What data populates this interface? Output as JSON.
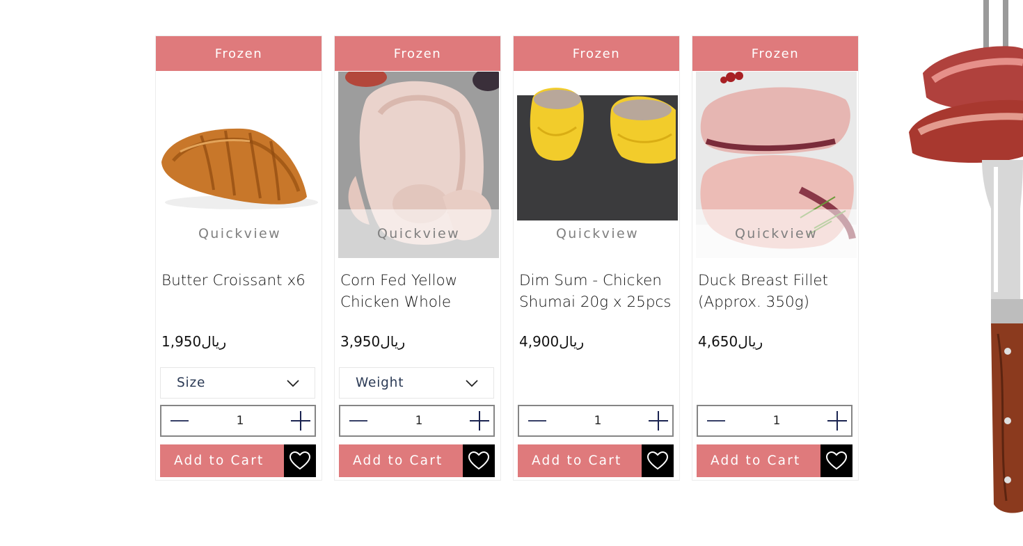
{
  "products": [
    {
      "ribbon": "Frozen",
      "quickview": "Quickview",
      "name": "Butter Croissant x6",
      "price": "1,950ريال",
      "option_label": "Size",
      "quantity": "1",
      "add_to_cart": "Add to Cart",
      "image_icon": "croissant-image"
    },
    {
      "ribbon": "Frozen",
      "quickview": "Quickview",
      "name": "Corn Fed Yellow Chicken Whole",
      "price": "3,950ريال",
      "option_label": "Weight",
      "quantity": "1",
      "add_to_cart": "Add to Cart",
      "image_icon": "whole-chicken-image"
    },
    {
      "ribbon": "Frozen",
      "quickview": "Quickview",
      "name": "Dim Sum - Chicken Shumai 20g x 25pcs",
      "price": "4,900ريال",
      "option_label": null,
      "quantity": "1",
      "add_to_cart": "Add to Cart",
      "image_icon": "dim-sum-image"
    },
    {
      "ribbon": "Frozen",
      "quickview": "Quickview",
      "name": "Duck Breast Fillet (Approx. 350g)",
      "price": "4,650ريال",
      "option_label": null,
      "quantity": "1",
      "add_to_cart": "Add to Cart",
      "image_icon": "duck-breast-image"
    }
  ],
  "colors": {
    "accent": "#df7a7c",
    "wishlist_bg": "#000000",
    "select_text": "#2b3a55",
    "qty_icon": "#1a2350"
  },
  "icons": {
    "dropdown": "chevron-down-icon",
    "decrease": "minus-icon",
    "increase": "plus-icon",
    "wishlist": "heart-icon",
    "decor": "steak-on-fork-image"
  }
}
